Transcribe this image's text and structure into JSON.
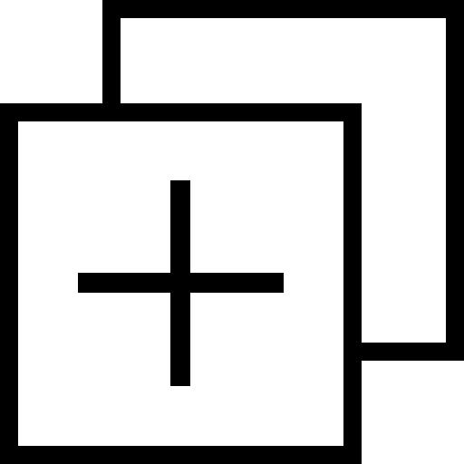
{
  "icon": {
    "name": "duplicate-add-icon",
    "stroke_color": "#000000",
    "background_color": "#ffffff"
  }
}
